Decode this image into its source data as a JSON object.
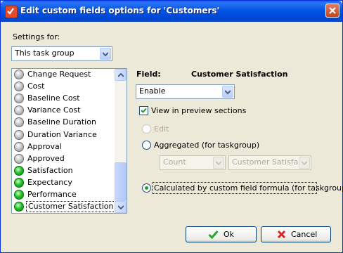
{
  "window": {
    "title": "Edit custom fields options for  'Customers'"
  },
  "settings_for": {
    "label": "Settings for:",
    "value": "This task group"
  },
  "field_list": {
    "items": [
      {
        "label": "Change Request",
        "status": "grey"
      },
      {
        "label": "Cost",
        "status": "grey"
      },
      {
        "label": "Baseline Cost",
        "status": "grey"
      },
      {
        "label": "Variance Cost",
        "status": "grey"
      },
      {
        "label": "Baseline Duration",
        "status": "grey"
      },
      {
        "label": "Duration Variance",
        "status": "grey"
      },
      {
        "label": "Approval",
        "status": "grey"
      },
      {
        "label": "Approved",
        "status": "grey"
      },
      {
        "label": "Satisfaction",
        "status": "green"
      },
      {
        "label": "Expectancy",
        "status": "green"
      },
      {
        "label": "Performance",
        "status": "green"
      },
      {
        "label": "Customer Satisfaction",
        "status": "green",
        "selected": true
      }
    ]
  },
  "field": {
    "label": "Field:",
    "name": "Customer Satisfaction",
    "mode_value": "Enable",
    "view_in_preview": {
      "label": "View in preview sections",
      "checked": true
    },
    "options": {
      "edit": {
        "label": "Edit",
        "enabled": false,
        "selected": false
      },
      "aggregated": {
        "label": "Aggregated (for taskgroup)",
        "enabled": true,
        "selected": false
      },
      "calculated": {
        "label": "Calculated by custom field formula (for taskgroup)",
        "enabled": true,
        "selected": true
      }
    },
    "aggregate_function": "Count",
    "aggregate_field": "Customer Satisfactic"
  },
  "buttons": {
    "ok": "Ok",
    "cancel": "Cancel"
  },
  "colors": {
    "titlebar": "#0054E3",
    "status_grey": "#9A9A9A",
    "status_green": "#22B022",
    "radio_selected": "#21A121"
  },
  "icons": {
    "app": "app-icon",
    "close": "close-icon",
    "ok": "checkmark-icon",
    "cancel": "x-icon"
  }
}
